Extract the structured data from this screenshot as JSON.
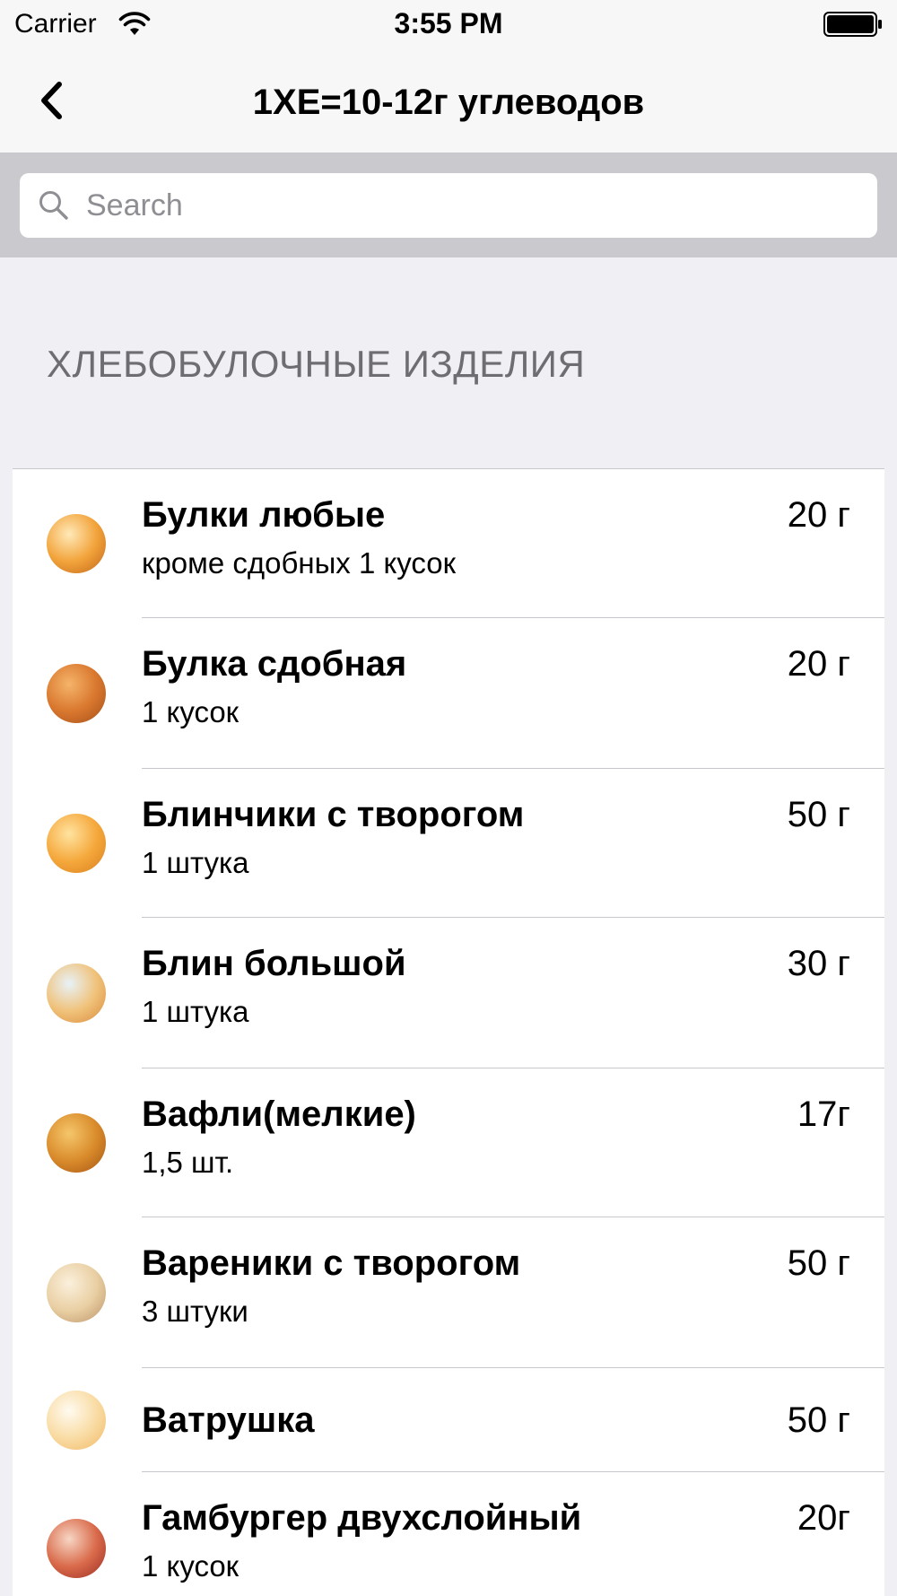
{
  "status_bar": {
    "carrier": "Carrier",
    "time": "3:55 PM"
  },
  "nav": {
    "title": "1ХЕ=10-12г углеводов",
    "back_icon": "chevron-left-icon"
  },
  "search": {
    "placeholder": "Search",
    "value": ""
  },
  "section": {
    "header": "ХЛЕБОБУЛОЧНЫЕ ИЗДЕЛИЯ"
  },
  "items": [
    {
      "title": "Булки любые",
      "subtitle": "кроме сдобных 1 кусок",
      "value": "20 г",
      "thumb_colors": [
        "#ffe9b8",
        "#f2a33a",
        "#c0651b"
      ]
    },
    {
      "title": "Булка сдобная",
      "subtitle": "1 кусок",
      "value": "20 г",
      "thumb_colors": [
        "#f5b46a",
        "#d9772e",
        "#a34f1a"
      ]
    },
    {
      "title": "Блинчики с творогом",
      "subtitle": "1 штука",
      "value": "50 г",
      "thumb_colors": [
        "#ffe3a0",
        "#f5a83c",
        "#d87f1e"
      ]
    },
    {
      "title": "Блин большой",
      "subtitle": "1 штука",
      "value": "30 г",
      "thumb_colors": [
        "#e8f2f8",
        "#f0c27a",
        "#d98a3a"
      ]
    },
    {
      "title": "Вафли(мелкие)",
      "subtitle": "1,5 шт.",
      "value": "17г",
      "thumb_colors": [
        "#f5c66a",
        "#d98b2b",
        "#a45413"
      ]
    },
    {
      "title": "Вареники с творогом",
      "subtitle": "3 штуки",
      "value": "50 г",
      "thumb_colors": [
        "#fbf0dc",
        "#e9cfa3",
        "#b99266"
      ]
    },
    {
      "title": "Ватрушка",
      "subtitle": "",
      "value": "50 г",
      "thumb_colors": [
        "#fffaf0",
        "#f9dca4",
        "#f1b765"
      ]
    },
    {
      "title": "Гамбургер двухслойный",
      "subtitle": "1 кусок",
      "value": "20г",
      "thumb_colors": [
        "#f7d6c4",
        "#d96a4a",
        "#9a2c25"
      ]
    }
  ]
}
